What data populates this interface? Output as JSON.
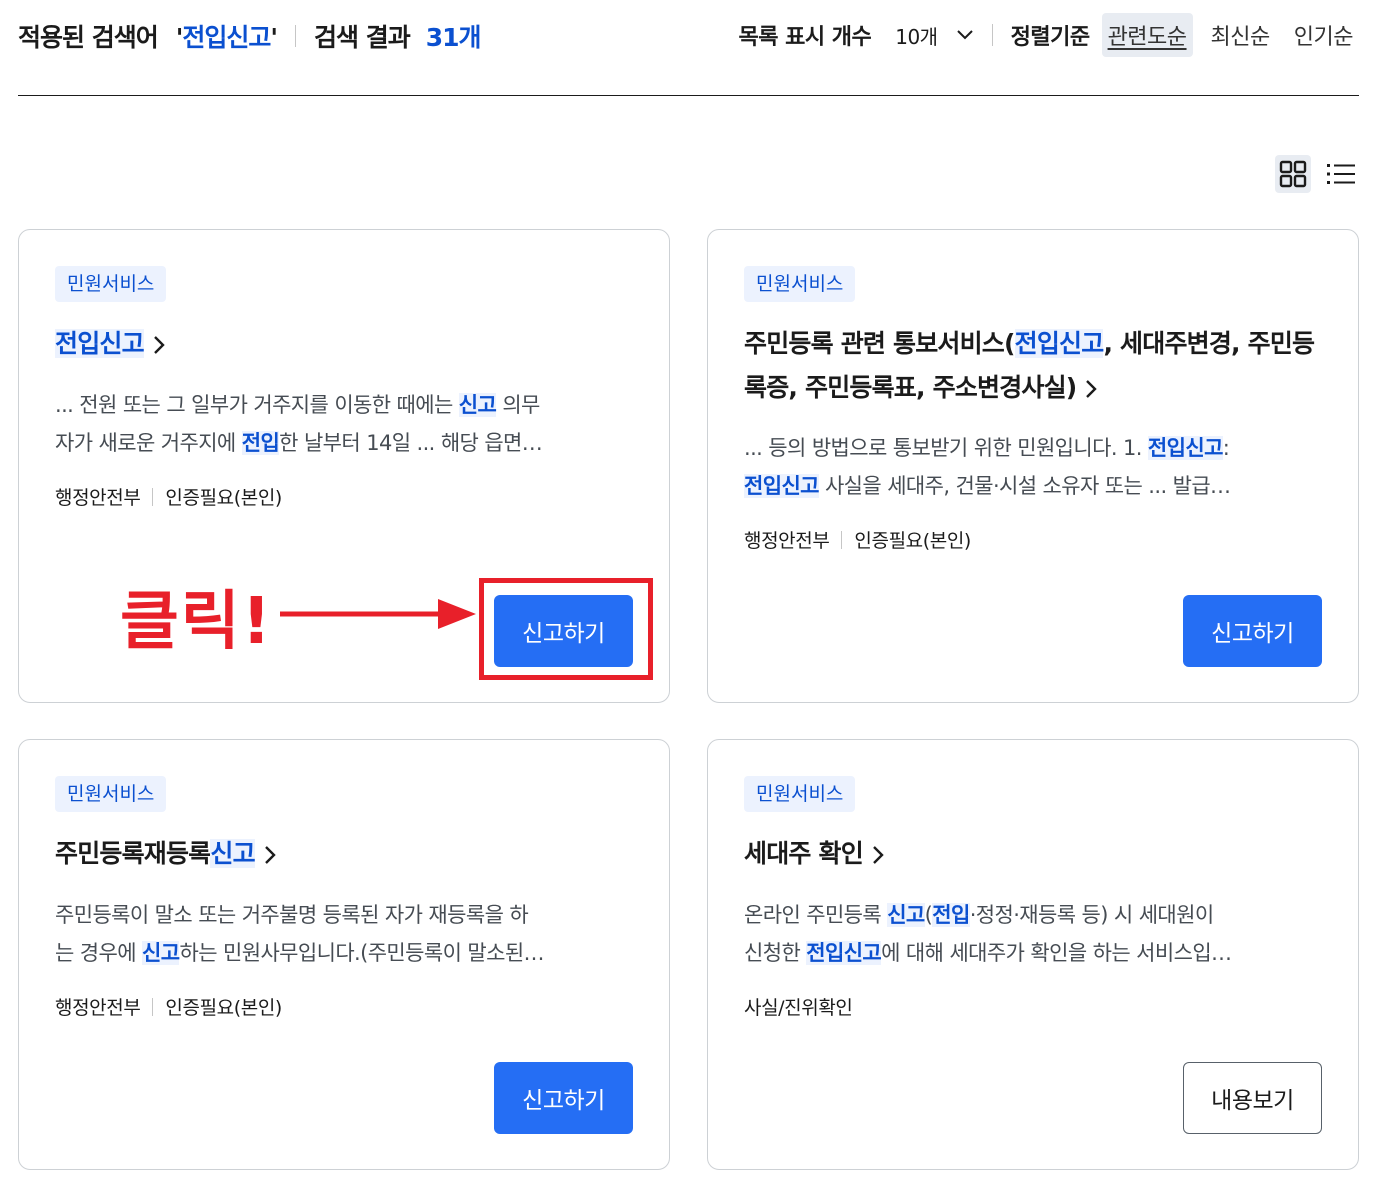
{
  "search_header": {
    "applied_label": "적용된 검색어",
    "quote_open": "'",
    "keyword": "전입신고",
    "quote_close": "'",
    "result_label": "검색 결과",
    "result_count": "31개"
  },
  "list_controls": {
    "per_page_label": "목록 표시 개수",
    "per_page_value": "10개",
    "sort_label": "정렬기준",
    "sort_options": [
      "관련도순",
      "최신순",
      "인기순"
    ],
    "active_sort": "관련도순"
  },
  "view_modes": {
    "grid_icon": "grid-view-icon",
    "list_icon": "list-view-icon",
    "active": "grid"
  },
  "cards": [
    {
      "tag": "민원서비스",
      "title_parts": [
        {
          "t": "전입신고",
          "hl": true
        }
      ],
      "desc_lines": [
        [
          {
            "t": "... 전원 또는 그 일부가 거주지를 이동한 때에는 "
          },
          {
            "t": "신고",
            "hl": true
          },
          {
            "t": " 의무"
          }
        ],
        [
          {
            "t": "자가 새로운 거주지에 "
          },
          {
            "t": "전입",
            "hl": true
          },
          {
            "t": "한 날부터 14일 ... 해당 읍면…"
          }
        ]
      ],
      "meta": [
        "행정안전부",
        "인증필요(본인)"
      ],
      "button": "신고하기"
    },
    {
      "tag": "민원서비스",
      "title_parts": [
        {
          "t": "주민등록 관련 통보서비스("
        },
        {
          "t": "전입신고",
          "hl": true
        },
        {
          "t": ", 세대주변경, 주민등록증, 주민등록표, 주소변경사실)"
        }
      ],
      "desc_lines": [
        [
          {
            "t": "... 등의 방법으로 통보받기 위한 민원입니다. 1. "
          },
          {
            "t": "전입신고",
            "hl": true
          },
          {
            "t": ":"
          }
        ],
        [
          {
            "t": "전입신고",
            "hl": true
          },
          {
            "t": " 사실을 세대주, 건물·시설 소유자 또는 ... 발급…"
          }
        ]
      ],
      "meta": [
        "행정안전부",
        "인증필요(본인)"
      ],
      "button": "신고하기"
    },
    {
      "tag": "민원서비스",
      "title_parts": [
        {
          "t": "주민등록재등록"
        },
        {
          "t": "신고",
          "hl": true
        }
      ],
      "desc_lines": [
        [
          {
            "t": "주민등록이 말소 또는 거주불명 등록된 자가 재등록을 하"
          }
        ],
        [
          {
            "t": "는 경우에 "
          },
          {
            "t": "신고",
            "hl": true
          },
          {
            "t": "하는 민원사무입니다.(주민등록이 말소된…"
          }
        ]
      ],
      "meta": [
        "행정안전부",
        "인증필요(본인)"
      ],
      "button": "신고하기"
    },
    {
      "tag": "민원서비스",
      "title_parts": [
        {
          "t": "세대주 확인"
        }
      ],
      "desc_lines": [
        [
          {
            "t": "온라인 주민등록 "
          },
          {
            "t": "신고",
            "hl": true
          },
          {
            "t": "("
          },
          {
            "t": "전입",
            "hl": true
          },
          {
            "t": "·정정·재등록 등) 시 세대원이"
          }
        ],
        [
          {
            "t": "신청한 "
          },
          {
            "t": "전입신고",
            "hl": true
          },
          {
            "t": "에 대해 세대주가 확인을 하는 서비스입…"
          }
        ]
      ],
      "meta": [
        "사실/진위확인"
      ],
      "button": "내용보기"
    }
  ],
  "annotation": {
    "text": "클릭!",
    "color": "#e8202a"
  },
  "colors": {
    "accent": "#0b50d0",
    "button": "#256ef4",
    "highlight_bg": "#ecf2fe"
  }
}
